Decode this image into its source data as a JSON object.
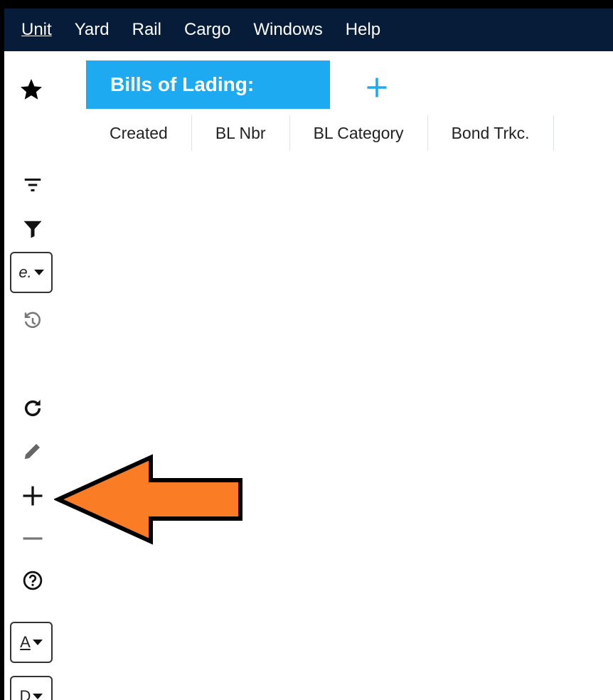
{
  "menubar": {
    "items": [
      {
        "label": "Unit"
      },
      {
        "label": "Yard"
      },
      {
        "label": "Rail"
      },
      {
        "label": "Cargo"
      },
      {
        "label": "Windows"
      },
      {
        "label": "Help"
      }
    ]
  },
  "tabs": {
    "active_label": "Bills of Lading:",
    "add_icon": "plus-icon"
  },
  "columns": [
    "Created",
    "BL Nbr",
    "BL Category",
    "Bond Trkc."
  ],
  "sidebar": {
    "view_dropdown_value": "e.",
    "sort_dropdown_value": "A",
    "display_dropdown_value": "D"
  },
  "colors": {
    "menubar_bg": "#061c38",
    "tab_active_bg": "#1eaaf1",
    "arrow_fill": "#fa7d25"
  }
}
